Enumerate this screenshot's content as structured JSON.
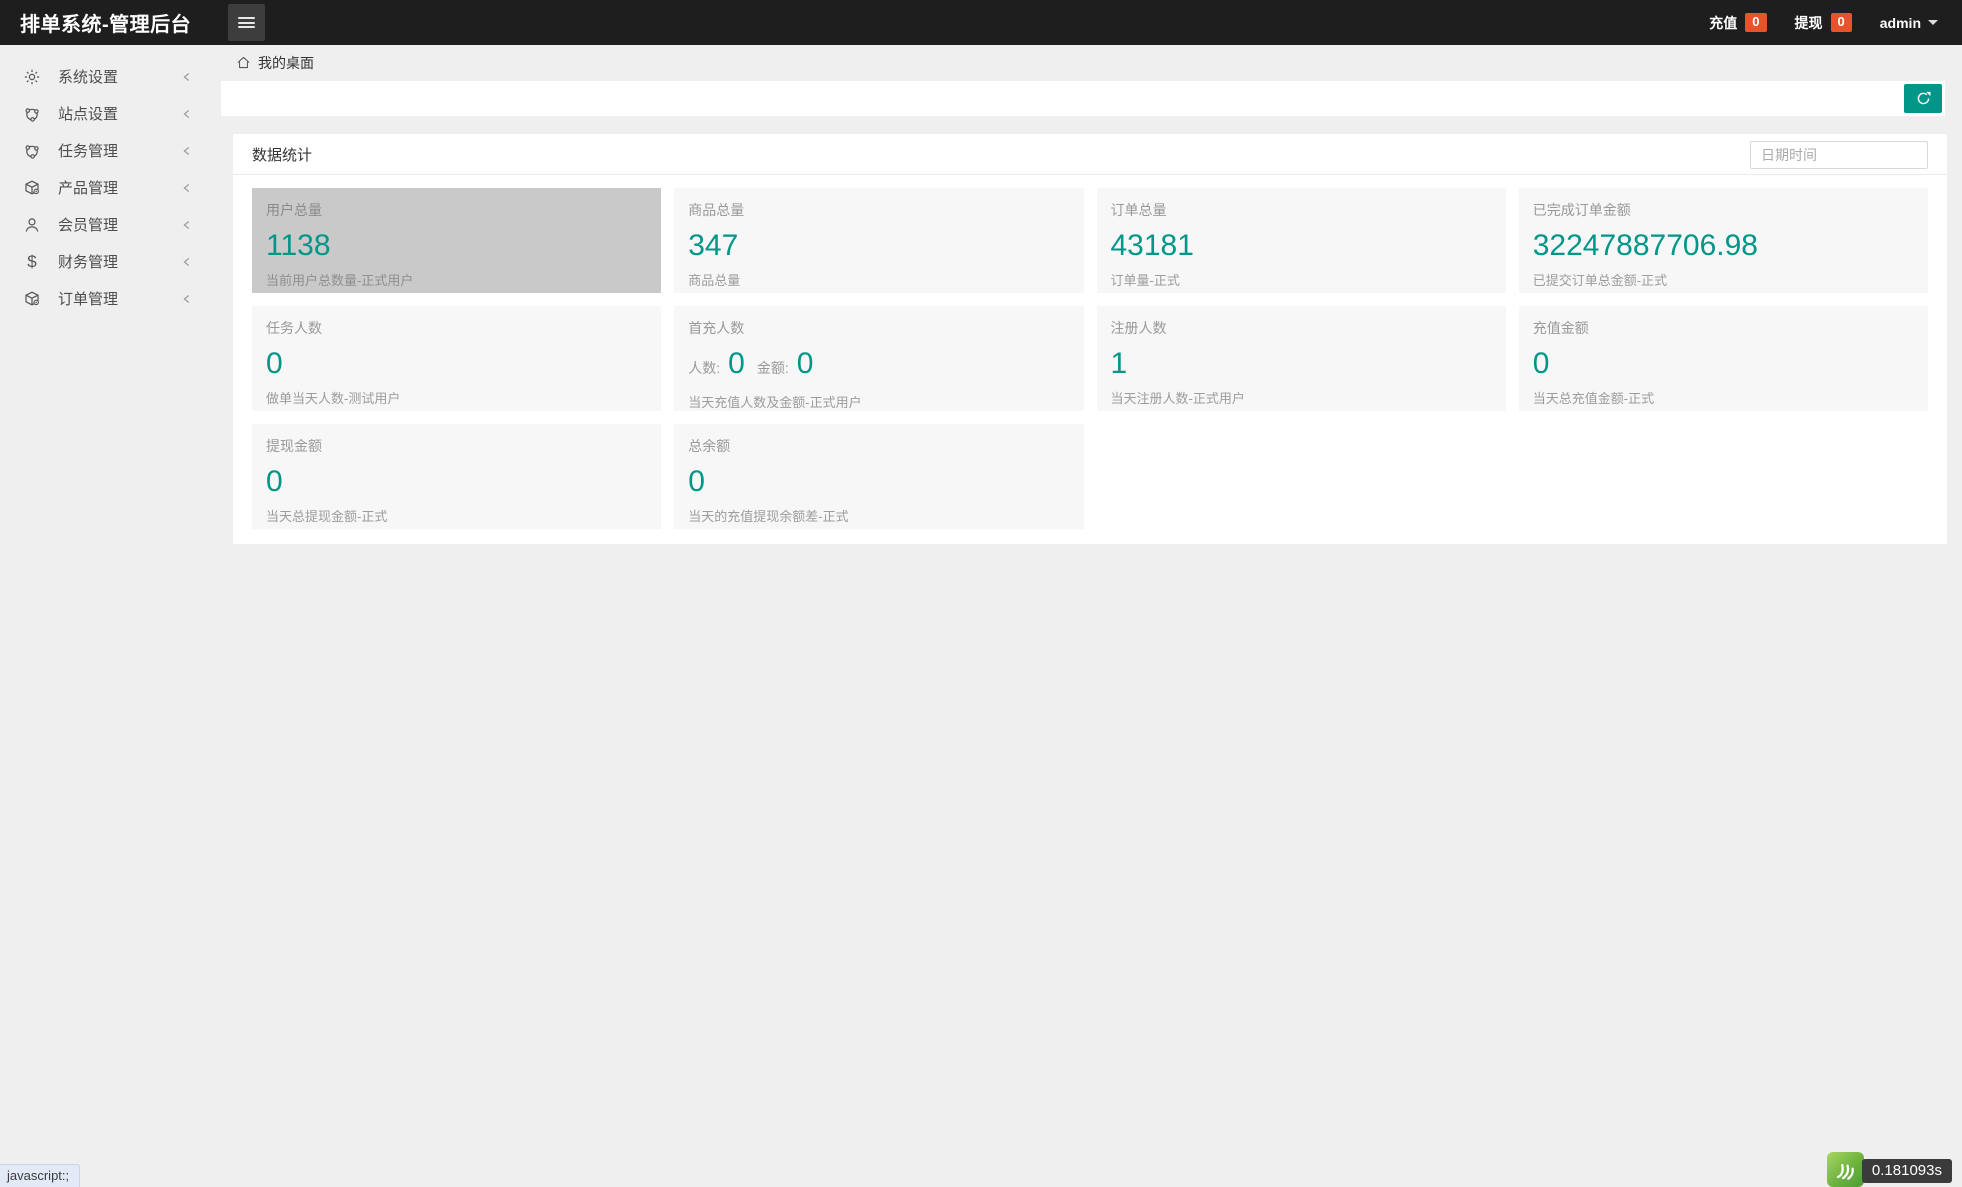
{
  "header": {
    "title": "排单系统-管理后台",
    "nav": [
      {
        "key": "recharge",
        "label": "充值",
        "count": "0"
      },
      {
        "key": "withdraw",
        "label": "提现",
        "count": "0"
      }
    ],
    "user": "admin"
  },
  "sidebar": {
    "items": [
      {
        "key": "system-settings",
        "label": "系统设置",
        "icon": "gear-icon"
      },
      {
        "key": "site-settings",
        "label": "站点设置",
        "icon": "cloud-node-icon"
      },
      {
        "key": "task-management",
        "label": "任务管理",
        "icon": "cloud-node-icon"
      },
      {
        "key": "product-management",
        "label": "产品管理",
        "icon": "cube-gear-icon"
      },
      {
        "key": "member-management",
        "label": "会员管理",
        "icon": "user-icon"
      },
      {
        "key": "finance-management",
        "label": "财务管理",
        "icon": "dollar-icon"
      },
      {
        "key": "order-management",
        "label": "订单管理",
        "icon": "cube-gear-icon"
      }
    ]
  },
  "breadcrumb": {
    "label": "我的桌面"
  },
  "panel": {
    "title": "数据统计",
    "date_placeholder": "日期时间",
    "cards": [
      {
        "key": "user-total",
        "title": "用户总量",
        "value": "1138",
        "desc": "当前用户总数量-正式用户",
        "highlight": true
      },
      {
        "key": "product-total",
        "title": "商品总量",
        "value": "347",
        "desc": "商品总量"
      },
      {
        "key": "order-total",
        "title": "订单总量",
        "value": "43181",
        "desc": "订单量-正式"
      },
      {
        "key": "completed-order-amount",
        "title": "已完成订单金额",
        "value": "32247887706.98",
        "desc": "已提交订单总金额-正式"
      },
      {
        "key": "task-users",
        "title": "任务人数",
        "value": "0",
        "desc": "做单当天人数-测试用户"
      },
      {
        "key": "first-charge",
        "title": "首充人数",
        "pairs": [
          {
            "label": "人数:",
            "value": "0"
          },
          {
            "label": "金额:",
            "value": "0"
          }
        ],
        "desc": "当天充值人数及金额-正式用户"
      },
      {
        "key": "registered-users",
        "title": "注册人数",
        "value": "1",
        "desc": "当天注册人数-正式用户"
      },
      {
        "key": "recharge-amount",
        "title": "充值金额",
        "value": "0",
        "desc": "当天总充值金额-正式"
      },
      {
        "key": "withdraw-amount",
        "title": "提现金额",
        "value": "0",
        "desc": "当天总提现金额-正式"
      },
      {
        "key": "total-balance",
        "title": "总余额",
        "value": "0",
        "desc": "当天的充值提现余额差-正式"
      }
    ]
  },
  "footer": {
    "link_hint": "javascript:;",
    "load_time": "0.181093s"
  },
  "colors": {
    "accent": "#009688",
    "badge": "#e8532c",
    "header_bg": "#1e1e1e",
    "sidebar_bg": "#efefef",
    "card_highlight_bg": "#c9c9c9",
    "card_bg": "#f7f7f7",
    "loader_green": "#6cb33f"
  }
}
